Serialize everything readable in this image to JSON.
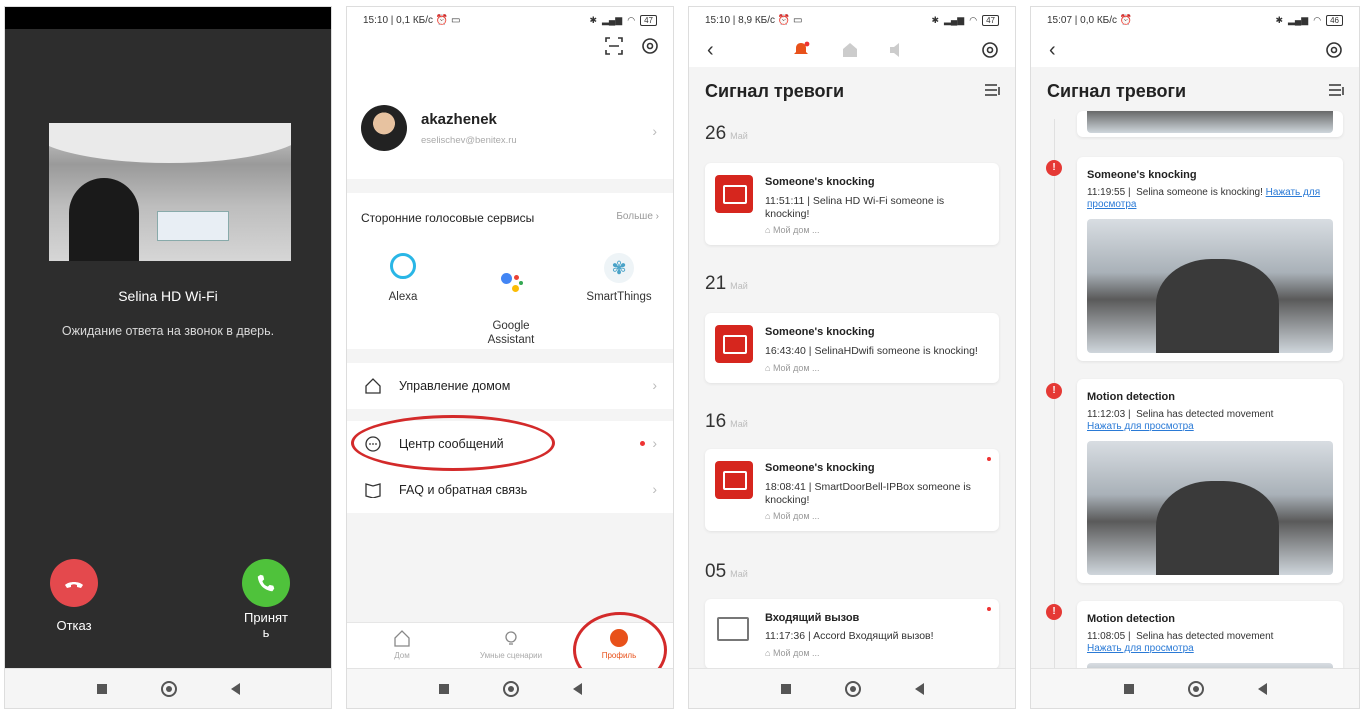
{
  "phone1": {
    "device_name": "Selina HD Wi-Fi",
    "status": "Ожидание ответа на звонок в дверь.",
    "decline_label": "Отказ",
    "accept_label": "Принят\nь"
  },
  "phone2": {
    "statusbar": {
      "time": "15:10 | 0,1 КБ/с ⏰ ▭",
      "battery": "47"
    },
    "user": {
      "name": "akazhenek",
      "email": "eselischev@benitex.ru"
    },
    "voice": {
      "title": "Сторонние голосовые сервисы",
      "more": "Больше",
      "services": [
        {
          "label": "Alexa",
          "icon": "alexa-icon"
        },
        {
          "label": "Google\nAssistant",
          "icon": "google-assistant-icon"
        },
        {
          "label": "SmartThings",
          "icon": "smartthings-icon"
        }
      ]
    },
    "menu": {
      "home": "Управление домом",
      "messages": "Центр сообщений",
      "faq": "FAQ и обратная связь"
    },
    "tabs": [
      {
        "label": "Дом",
        "icon": "home-icon"
      },
      {
        "label": "Умные сценарии",
        "icon": "bulb-icon"
      },
      {
        "label": "Профиль",
        "icon": "profile-icon"
      }
    ],
    "accent": "#e8511a"
  },
  "phone3": {
    "statusbar": {
      "time": "15:10 | 8,9 КБ/с ⏰ ▭",
      "battery": "47"
    },
    "title": "Сигнал тревоги",
    "groups": [
      {
        "day": "26",
        "month": "Май",
        "event": {
          "title": "Someone's knocking",
          "time": "11:51:11",
          "desc": "Selina HD Wi-Fi someone is knocking!",
          "home": "Мой дом ..."
        }
      },
      {
        "day": "21",
        "month": "Май",
        "event": {
          "title": "Someone's knocking",
          "time": "16:43:40",
          "desc": "SelinaHDwifi someone is knocking!",
          "home": "Мой дом ..."
        }
      },
      {
        "day": "16",
        "month": "Май",
        "event": {
          "title": "Someone's knocking",
          "time": "18:08:41",
          "desc": "SmartDoorBell-IPBox someone is knocking!",
          "home": "Мой дом ..."
        }
      },
      {
        "day": "05",
        "month": "Май",
        "event": {
          "title": "Входящий вызов",
          "time": "11:17:36",
          "desc": "Accord Входящий вызов!",
          "home": "Мой дом ..."
        }
      }
    ],
    "alert_color": "#d6261e"
  },
  "phone4": {
    "statusbar": {
      "time": "15:07 | 0,0 КБ/с ⏰",
      "battery": "46"
    },
    "title": "Сигнал тревоги",
    "events": [
      {
        "title": "Someone's knocking",
        "time": "11:19:55",
        "desc": "Selina someone is knocking!",
        "link": "Нажать для просмотра"
      },
      {
        "title": "Motion detection",
        "time": "11:12:03",
        "desc": "Selina has detected movement",
        "link": "Нажать для просмотра"
      },
      {
        "title": "Motion detection",
        "time": "11:08:05",
        "desc": "Selina has detected movement",
        "link": "Нажать для просмотра"
      }
    ],
    "link_color": "#2a7ad6"
  }
}
